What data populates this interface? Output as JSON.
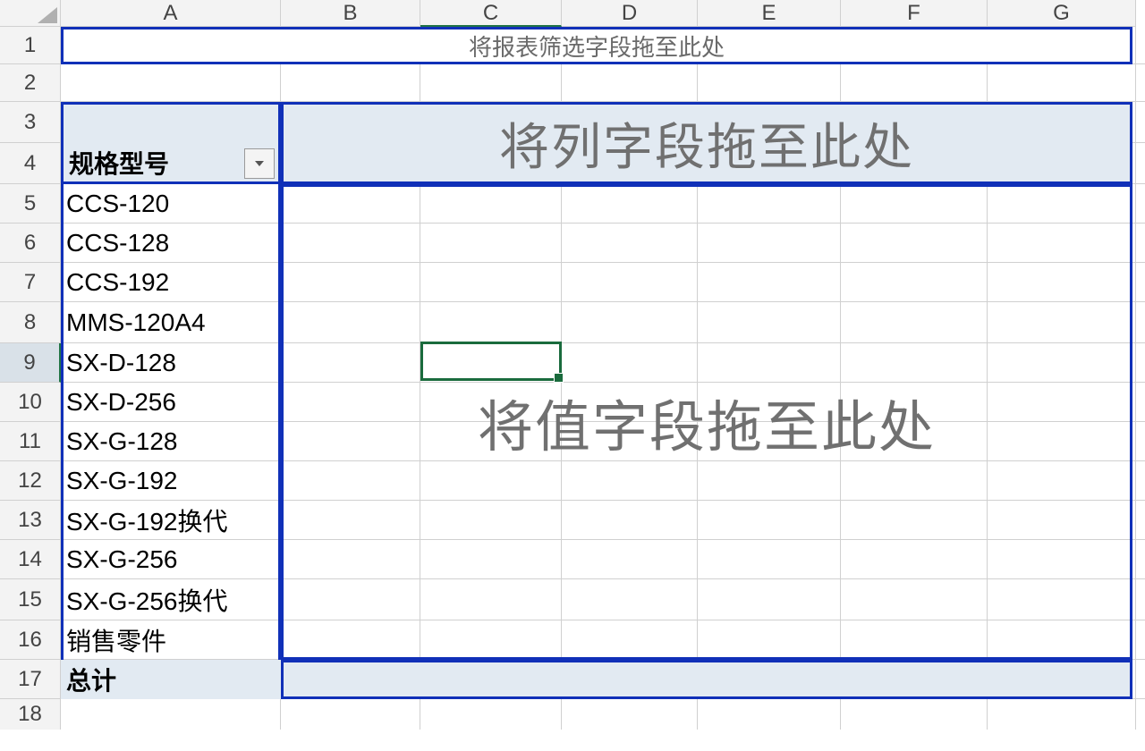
{
  "columns": [
    "A",
    "B",
    "C",
    "D",
    "E",
    "F",
    "G"
  ],
  "rows": [
    "1",
    "2",
    "3",
    "4",
    "5",
    "6",
    "7",
    "8",
    "9",
    "10",
    "11",
    "12",
    "13",
    "14",
    "15",
    "16",
    "17",
    "18"
  ],
  "active_cell": "C9",
  "pivot": {
    "filter_hint": "将报表筛选字段拖至此处",
    "columns_hint": "将列字段拖至此处",
    "values_hint": "将值字段拖至此处",
    "row_field": "规格型号",
    "row_items": [
      "CCS-120",
      "CCS-128",
      "CCS-192",
      "MMS-120A4",
      "SX-D-128",
      "SX-D-256",
      "SX-G-128",
      "SX-G-192",
      "SX-G-192换代",
      "SX-G-256",
      "SX-G-256换代",
      "销售零件"
    ],
    "grand_total": "总计"
  }
}
